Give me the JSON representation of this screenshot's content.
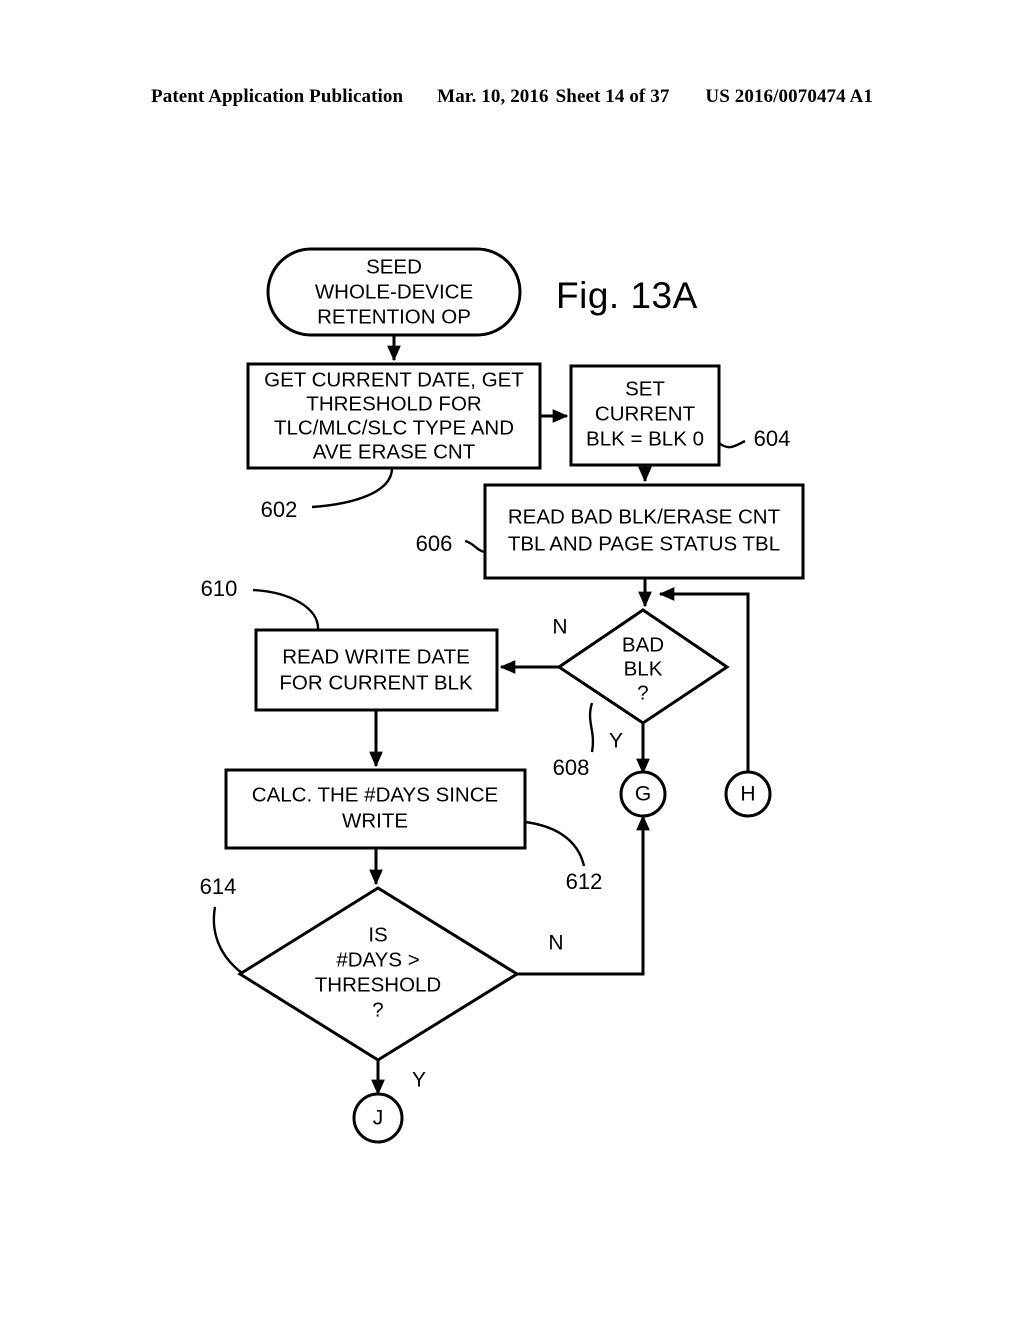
{
  "header": {
    "publication": "Patent Application Publication",
    "date": "Mar. 10, 2016",
    "sheet": "Sheet 14 of 37",
    "patent_number": "US 2016/0070474 A1"
  },
  "figure": {
    "title": "Fig. 13A"
  },
  "nodes": {
    "start": {
      "line1": "SEED",
      "line2": "WHOLE-DEVICE",
      "line3": "RETENTION OP"
    },
    "get_current_date": {
      "line1": "GET CURRENT DATE, GET",
      "line2": "THRESHOLD FOR",
      "line3": "TLC/MLC/SLC TYPE AND",
      "line4": "AVE ERASE CNT"
    },
    "set_current_blk": {
      "line1": "SET",
      "line2": "CURRENT",
      "line3": "BLK = BLK 0"
    },
    "read_bad_blk": {
      "line1": "READ BAD BLK/ERASE CNT",
      "line2": "TBL AND PAGE STATUS TBL"
    },
    "bad_blk_decision": {
      "line1": "BAD",
      "line2": "BLK",
      "line3": "?"
    },
    "read_write_date": {
      "line1": "READ WRITE DATE",
      "line2": "FOR CURRENT BLK"
    },
    "calc_days": {
      "line1": "CALC. THE #DAYS SINCE",
      "line2": "WRITE"
    },
    "days_threshold_decision": {
      "line1": "IS",
      "line2": "#DAYS >",
      "line3": "THRESHOLD",
      "line4": "?"
    },
    "connector_g": {
      "label": "G"
    },
    "connector_h": {
      "label": "H"
    },
    "connector_j": {
      "label": "J"
    }
  },
  "branch_labels": {
    "bad_blk_no": "N",
    "bad_blk_yes": "Y",
    "days_no": "N",
    "days_yes": "Y"
  },
  "reference_numerals": {
    "get_current_date": "602",
    "set_current_blk": "604",
    "read_bad_blk": "606",
    "bad_blk_decision": "608",
    "read_write_date": "610",
    "calc_days": "612",
    "days_threshold_decision": "614"
  },
  "colors": {
    "ink": "#000000",
    "paper": "#ffffff"
  }
}
